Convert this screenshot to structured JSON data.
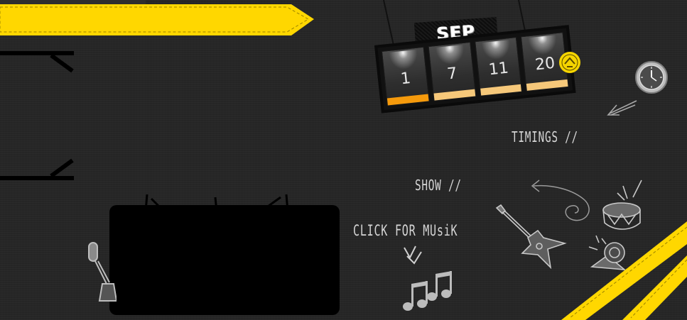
{
  "calendar": {
    "month": "SEP",
    "days": [
      {
        "label": "1",
        "accent": "#f59a0c"
      },
      {
        "label": "7",
        "accent": "#f6c87a"
      },
      {
        "label": "11",
        "accent": "#f6c87a"
      },
      {
        "label": "20",
        "accent": "#f6c87a"
      }
    ]
  },
  "nav": {
    "timings": "TIMINGS //",
    "show": "SHOW //",
    "music": "CLICK FOR MUsiK"
  },
  "icons": {
    "clock": "clock-icon",
    "music": "music-notes-icon",
    "guitar": "guitar-icon",
    "drum": "drum-icon",
    "speaker": "speaker-icon",
    "mic": "microphone-icon",
    "seal": "badge-seal-icon"
  },
  "colors": {
    "background": "#262626",
    "accent_yellow": "#ffd700",
    "video_box": "#000000"
  }
}
